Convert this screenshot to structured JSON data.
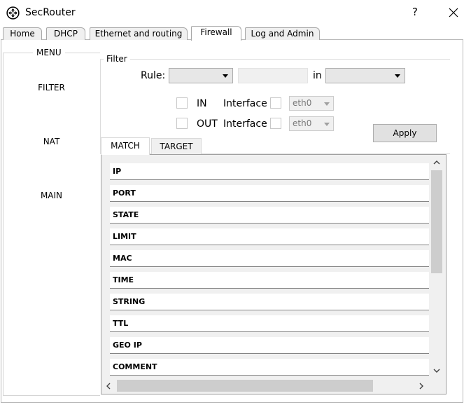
{
  "window": {
    "title": "SecRouter",
    "help_label": "?",
    "icons": {
      "app": "router-icon",
      "close": "close-icon"
    }
  },
  "tabs": [
    {
      "label": "Home",
      "active": false
    },
    {
      "label": "DHCP",
      "active": false
    },
    {
      "label": "Ethernet and routing",
      "active": false
    },
    {
      "label": "Firewall",
      "active": true
    },
    {
      "label": "Log and Admin",
      "active": false
    }
  ],
  "menu": {
    "title": "MENU",
    "items": [
      "FILTER",
      "NAT",
      "MAIN"
    ]
  },
  "filter": {
    "title": "Filter",
    "rule_label": "Rule:",
    "rule_select_value": "",
    "rule_text_value": "",
    "in_label": "in",
    "in_select_value": "",
    "in_checkbox_label": "IN",
    "out_checkbox_label": "OUT",
    "interface_label": "Interface",
    "in_interface_value": "eth0",
    "out_interface_value": "eth0",
    "apply_label": "Apply"
  },
  "subtabs": [
    {
      "label": "MATCH",
      "active": true
    },
    {
      "label": "TARGET",
      "active": false
    }
  ],
  "match_items": [
    "IP",
    "PORT",
    "STATE",
    "LIMIT",
    "MAC",
    "TIME",
    "STRING",
    "TTL",
    "GEO IP",
    "COMMENT"
  ],
  "colors": {
    "scroll_thumb": "#cdcdcd",
    "panel_bg": "#f0f0f0",
    "button_bg": "#e1e1e1"
  }
}
